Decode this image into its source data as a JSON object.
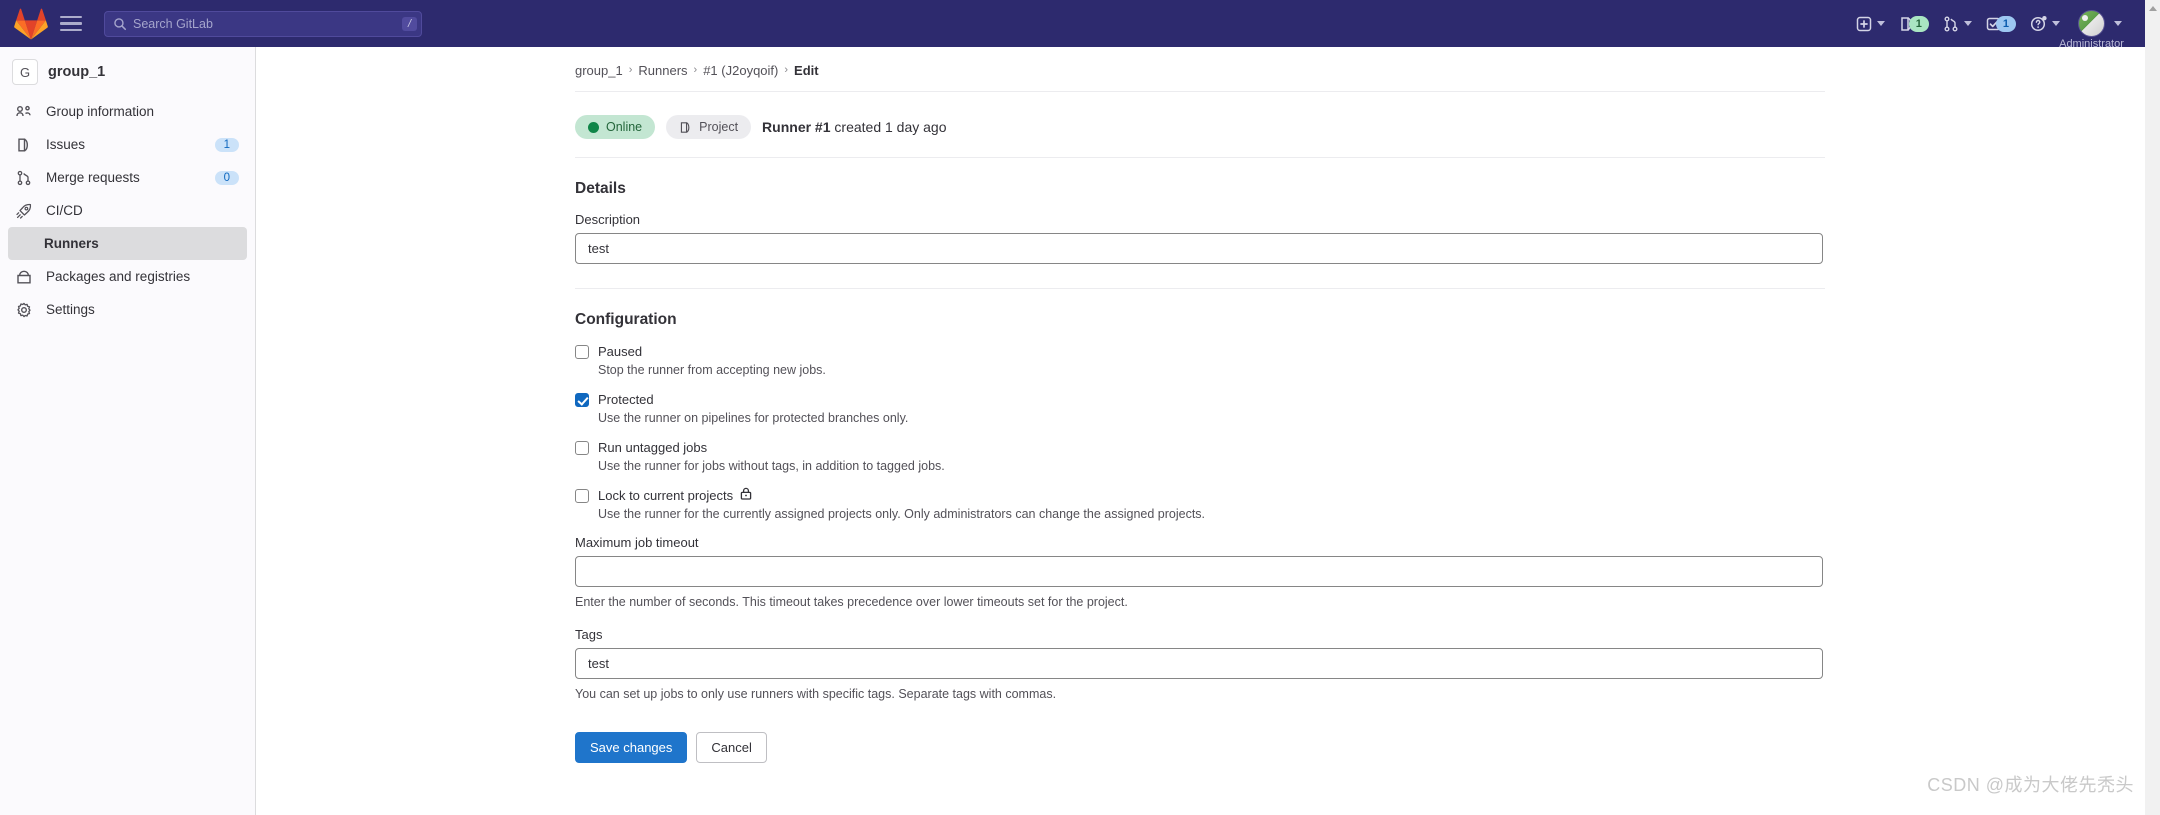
{
  "navbar": {
    "logo_icon": "gitlab-logo-icon",
    "menu_icon": "hamburger-menu-icon",
    "search": {
      "icon": "search-icon",
      "placeholder": "Search GitLab",
      "value": "",
      "shortcut_key": "/"
    },
    "right_items": [
      {
        "name": "create-new-menu",
        "icon": "plus-square-icon",
        "badge": "",
        "caret": true
      },
      {
        "name": "issues-menu",
        "icon": "issues-icon",
        "badge": "1",
        "badge_color": "green",
        "caret": false
      },
      {
        "name": "merge-requests-menu",
        "icon": "merge-request-icon",
        "badge": "",
        "caret": true
      },
      {
        "name": "todos-menu",
        "icon": "todo-checkbox-icon",
        "badge": "1",
        "badge_color": "blue",
        "caret": false
      },
      {
        "name": "help-menu",
        "icon": "question-circle-icon",
        "badge": "",
        "caret": true
      }
    ],
    "user": {
      "avatar_icon": "user-avatar",
      "name": "Administrator"
    }
  },
  "sidebar": {
    "group": {
      "initial": "G",
      "name": "group_1"
    },
    "items": [
      {
        "label": "Group information",
        "icon": "group-information-icon",
        "badge": "",
        "active": false,
        "sub": false
      },
      {
        "label": "Issues",
        "icon": "issues-icon",
        "badge": "1",
        "active": false,
        "sub": false
      },
      {
        "label": "Merge requests",
        "icon": "merge-request-icon",
        "badge": "0",
        "active": false,
        "sub": false
      },
      {
        "label": "CI/CD",
        "icon": "rocket-icon",
        "badge": "",
        "active": false,
        "sub": false
      },
      {
        "label": "Runners",
        "icon": "",
        "badge": "",
        "active": true,
        "sub": true
      },
      {
        "label": "Packages and registries",
        "icon": "package-icon",
        "badge": "",
        "active": false,
        "sub": false
      },
      {
        "label": "Settings",
        "icon": "gear-icon",
        "badge": "",
        "active": false,
        "sub": false
      }
    ]
  },
  "breadcrumb": {
    "items": [
      {
        "label": "group_1",
        "current": false
      },
      {
        "label": "Runners",
        "current": false
      },
      {
        "label": "#1 (J2oyqoif)",
        "current": false
      },
      {
        "label": "Edit",
        "current": true
      }
    ],
    "separator": "›"
  },
  "runner_header": {
    "status_badge": "Online",
    "status_dot_icon": "status-online-dot-icon",
    "scope_badge": "Project",
    "scope_icon": "project-door-icon",
    "title_strong": "Runner #1",
    "title_rest": " created 1 day ago"
  },
  "details": {
    "heading": "Details",
    "description_label": "Description",
    "description_value": "test",
    "description_placeholder": ""
  },
  "configuration": {
    "heading": "Configuration",
    "checkboxes": [
      {
        "name": "paused",
        "label": "Paused",
        "checked": false,
        "help": "Stop the runner from accepting new jobs.",
        "trailing_icon": ""
      },
      {
        "name": "protected",
        "label": "Protected",
        "checked": true,
        "help": "Use the runner on pipelines for protected branches only.",
        "trailing_icon": ""
      },
      {
        "name": "run-untagged-jobs",
        "label": "Run untagged jobs",
        "checked": false,
        "help": "Use the runner for jobs without tags, in addition to tagged jobs.",
        "trailing_icon": ""
      },
      {
        "name": "lock-to-current-projects",
        "label": "Lock to current projects",
        "checked": false,
        "help": "Use the runner for the currently assigned projects only. Only administrators can change the assigned projects.",
        "trailing_icon": "lock-icon"
      }
    ],
    "max_timeout_label": "Maximum job timeout",
    "max_timeout_value": "",
    "max_timeout_placeholder": "",
    "max_timeout_help": "Enter the number of seconds. This timeout takes precedence over lower timeouts set for the project.",
    "tags_label": "Tags",
    "tags_value": "test",
    "tags_placeholder": "",
    "tags_help": "You can set up jobs to only use runners with specific tags. Separate tags with commas."
  },
  "actions": {
    "save_label": "Save changes",
    "cancel_label": "Cancel"
  },
  "watermark": {
    "text": "CSDN @成为大佬先秃头"
  },
  "colors": {
    "navbar_bg": "#2d2a6e",
    "accent_blue": "#1f75cb",
    "link_blue": "#1068bf",
    "online_green": "#108548",
    "sidebar_bg": "#fbfafd",
    "active_item_bg": "#dcdcde"
  }
}
